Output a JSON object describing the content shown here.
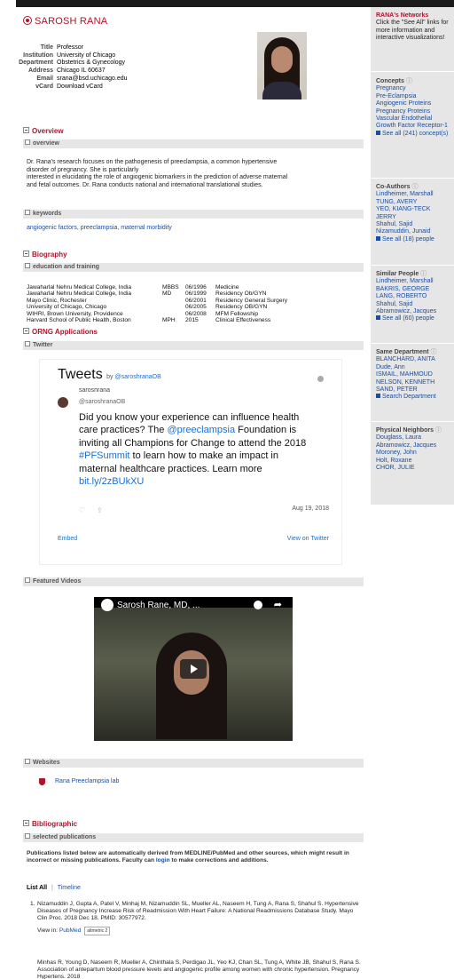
{
  "profile": {
    "name": "SAROSH RANA",
    "fields": [
      {
        "label": "Title",
        "value": "Professor"
      },
      {
        "label": "Institution",
        "value": "University of Chicago"
      },
      {
        "label": "Department",
        "value": "Obstetrics & Gynecology"
      },
      {
        "label": "Address",
        "value": "Chicago IL 60637"
      },
      {
        "label": "Email",
        "value": "srana@bsd.uchicago.edu"
      },
      {
        "label": "vCard",
        "value": "Download vCard"
      }
    ]
  },
  "overview": {
    "section": "Overview",
    "subsection": "overview",
    "text1": "Dr. Rana's research focuses on the pathogenesis of preeclampsia, a common hypertensive",
    "text2": "disorder of pregnancy. She is particularly",
    "text3": "interested in elucidating the role of angiogenic biomarkers in the prediction of adverse maternal",
    "text4": "and fetal outcomes. Dr. Rana conducts national and international translational studies.",
    "keywords_label": "keywords",
    "keywords": "angiogenic factors, preeclampsia, maternal morbidity"
  },
  "biography": {
    "section": "Biography",
    "subsection": "education and training",
    "rows": [
      {
        "inst": "Jawaharlal Nehru Medical College, India",
        "deg": "MBBS",
        "date": "06/1996",
        "field": "Medicine"
      },
      {
        "inst": "Jawaharlal Nehru Medical College, India",
        "deg": "MD",
        "date": "06/1999",
        "field": "Residency Ob/GYN"
      },
      {
        "inst": "Mayo Clinic, Rochester",
        "deg": "",
        "date": "06/2001",
        "field": "Residency General Surgery"
      },
      {
        "inst": "University of Chicago, Chicago",
        "deg": "",
        "date": "06/2005",
        "field": "Residency OB/GYN"
      },
      {
        "inst": "WIHRI, Brown University, Providence",
        "deg": "",
        "date": "06/2008",
        "field": "MFM Fellowship"
      },
      {
        "inst": "Harvard School of Public Health, Boston",
        "deg": "MPH",
        "date": "2015",
        "field": "Clinical Effectiveness"
      }
    ]
  },
  "orng": {
    "section": "ORNG Applications",
    "twitter_label": "Twitter",
    "tweets_title": "Tweets",
    "by": "by",
    "by_handle": "@saroshranaOB",
    "cut_name": "saroshrana",
    "handle": "@saroshranaOB",
    "tweet_pre": "Did you know your experience can influence health care practices? The ",
    "tweet_mention": "@preeclampsia",
    "tweet_mid": " Foundation is inviting all Champions for Change to attend the 2018 ",
    "tweet_tag": "#PFSummit",
    "tweet_post": " to learn how to make an impact in maternal healthcare practices. Learn more ",
    "tweet_link": "bit.ly/2zBUkXU",
    "date": "Aug 19, 2018",
    "embed": "Embed",
    "view": "View on Twitter",
    "videos_label": "Featured Videos",
    "video_title": "Sarosh Rane, MD, ...",
    "websites_label": "Websites",
    "website": "Rana Preeclampsia lab"
  },
  "bibliographic": {
    "section": "Bibliographic",
    "subsection": "selected publications",
    "note_pre": "Publications listed below are automatically derived from MEDLINE/PubMed and other sources, which might result in incorrect or missing publications. Faculty can ",
    "note_link": "login",
    "note_post": " to make corrections and additions.",
    "list_all": "List All",
    "sep": "|",
    "timeline": "Timeline",
    "pub1": "Nizamuddin J, Gupta A, Patel V, Minhaj M, Nizamuddin SL, Mueller AL, Naseem H, Tung A, Rana S, Shahul S. Hypertensive Diseases of Pregnancy Increase Risk of Readmission With Heart Failure: A National Readmissions Database Study. Mayo Clin Proc. 2018 Dec 18. PMID: 30577972.",
    "view_in": "View in:",
    "pubmed": "PubMed",
    "altmetric": "altmetric",
    "alt_score": "2",
    "pub2": "Minhas R, Young D, Naseem R, Mueller A, Chinthala S, Perdigao JL, Yeo KJ, Chan SL, Tung A, White JB, Shahul S, Rana S. Association of antepartum blood pressure levels and angiogenic profile among women with chronic hypertension. Pregnancy Hypertens. 2018"
  },
  "sidebar": {
    "networks_title": "RANA's Networks",
    "networks_text": "Click the \"See All\" links for more information and interactive visualizations!",
    "concepts_title": "Concepts",
    "concepts": [
      "Pregnancy",
      "Pre-Eclampsia",
      "Angiogenic Proteins",
      "Pregnancy Proteins",
      "Vascular Endothelial Growth Factor Receptor-1"
    ],
    "concepts_see": "See all (241) concept(s)",
    "coauthors_title": "Co-Authors",
    "coauthors": [
      "Lindheimer, Marshall",
      "TUNG, AVERY",
      "YEO, KIANG-TECK JERRY",
      "Shahul, Sajid",
      "Nizamuddin, Junaid"
    ],
    "coauthors_see": "See all (18) people",
    "similar_title": "Similar People",
    "similar": [
      "Lindheimer, Marshall",
      "BAKRIS, GEORGE",
      "LANG, ROBERTO",
      "Shahul, Sajid",
      "Abramowicz, Jacques"
    ],
    "similar_see": "See all (60) people",
    "samedept_title": "Same Department",
    "samedept": [
      "BLANCHARD, ANITA",
      "Dude, Ann",
      "ISMAIL, MAHMOUD",
      "NELSON, KENNETH",
      "SAND, PETER"
    ],
    "samedept_see": "Search Department",
    "physical_title": "Physical Neighbors",
    "physical": [
      "Douglass, Laura",
      "Abramowicz, Jacques",
      "Moroney, John",
      "Holt, Roxane",
      "CHOR, JULIE"
    ]
  }
}
